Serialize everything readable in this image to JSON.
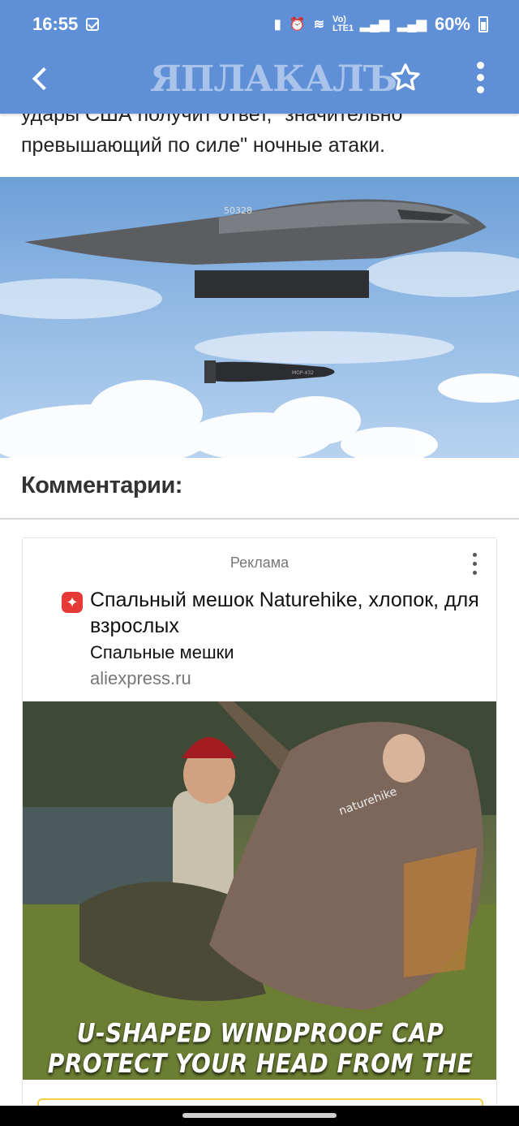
{
  "status_bar": {
    "time": "16:55",
    "network": "Vo) LTE1",
    "battery": "60%"
  },
  "app_bar": {
    "logo_text": "ЯПЛАКАЛЪ",
    "back_icon": "chevron-left-icon",
    "favorite_icon": "star-outline-icon",
    "menu_icon": "more-vertical-icon"
  },
  "article": {
    "text_lines": [
      "удары США получит ответ, \"значительно",
      "превышающий по силе\" ночные атаки."
    ],
    "image": {
      "description_icon": "bomber-photo",
      "aircraft_marking": "50328",
      "bomb_marking": "MOP-432"
    }
  },
  "comments": {
    "title": "Комментарии:"
  },
  "ad": {
    "label": "Реклама",
    "menu_icon": "more-vertical-icon",
    "brand_icon": "aliexpress-icon",
    "title": "Спальный мешок Naturehike, хлопок, для взрослых",
    "category": "Спальные мешки",
    "domain": "aliexpress.ru",
    "image_caption_line1": "U-SHAPED WINDPROOF CAP",
    "image_caption_line2": "PROTECT YOUR HEAD FROM THE COLD",
    "bag_brand": "naturehike"
  },
  "colors": {
    "header_bg": "#5f8fd6",
    "logo": "#a9c3ea",
    "text": "#222222",
    "ad_label": "#777777"
  }
}
